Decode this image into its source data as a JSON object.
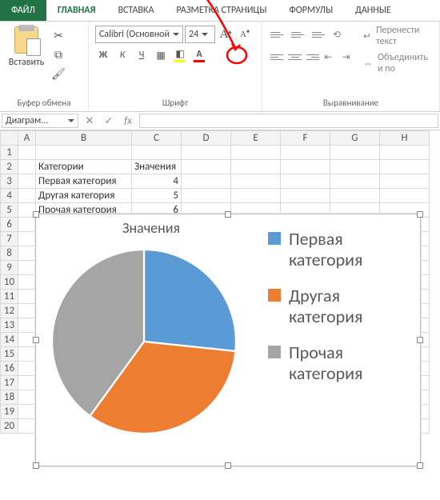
{
  "tabs": {
    "file": "ФАЙЛ",
    "home": "ГЛАВНАЯ",
    "insert": "ВСТАВКА",
    "layout": "РАЗМЕТКА СТРАНИЦЫ",
    "formulas": "ФОРМУЛЫ",
    "data": "ДАННЫЕ"
  },
  "ribbon": {
    "paste": "Вставить",
    "clipboard_group": "Буфер обмена",
    "font_group": "Шрифт",
    "alignment_group": "Выравнивание",
    "font_name": "Calibri (Основной",
    "font_size": "24",
    "grow_font": "A",
    "shrink_font": "A",
    "bold": "Ж",
    "italic": "К",
    "underline": "Ч",
    "wrap_text": "Перенести текст",
    "merge": "Объединить и по"
  },
  "namebox": "Диаграм...",
  "columns": [
    "A",
    "B",
    "C",
    "D",
    "E",
    "F",
    "G",
    "H"
  ],
  "rows": [
    "1",
    "2",
    "3",
    "4",
    "5",
    "6",
    "7",
    "8",
    "9",
    "10",
    "11",
    "12",
    "13",
    "14",
    "15",
    "16",
    "17",
    "18",
    "19",
    "20"
  ],
  "table": {
    "header": {
      "b": "Категории",
      "c": "Значения"
    },
    "rows": [
      {
        "b": "Первая категория",
        "c": "4"
      },
      {
        "b": "Другая категория",
        "c": "5"
      },
      {
        "b": "Прочая категория",
        "c": "6"
      }
    ]
  },
  "chart_data": {
    "type": "pie",
    "title": "Значения",
    "categories": [
      "Первая категория",
      "Другая категория",
      "Прочая категория"
    ],
    "values": [
      4,
      5,
      6
    ],
    "colors": [
      "#5b9bd5",
      "#ed7d31",
      "#a5a5a5"
    ],
    "legend_position": "right"
  }
}
